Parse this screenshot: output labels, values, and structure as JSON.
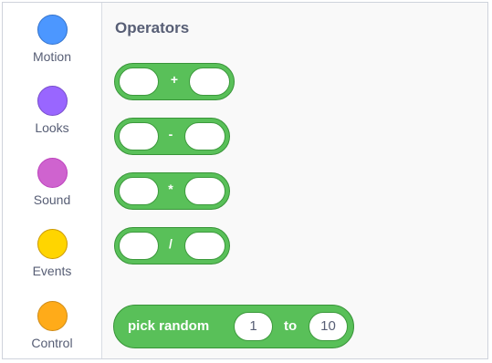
{
  "categories": [
    {
      "label": "Motion",
      "color": "#4c97ff",
      "border": "#3373cc"
    },
    {
      "label": "Looks",
      "color": "#9966ff",
      "border": "#774dcb"
    },
    {
      "label": "Sound",
      "color": "#cf63cf",
      "border": "#bd42bd"
    },
    {
      "label": "Events",
      "color": "#ffd500",
      "border": "#cc9900"
    },
    {
      "label": "Control",
      "color": "#ffab19",
      "border": "#cf8b17"
    }
  ],
  "palette": {
    "heading": "Operators",
    "block_color": "#59c059",
    "blocks": [
      {
        "operator": "+"
      },
      {
        "operator": "-"
      },
      {
        "operator": "*"
      },
      {
        "operator": "/"
      }
    ],
    "pick_random": {
      "label": "pick random",
      "from_value": "1",
      "to_label": "to",
      "to_value": "10"
    }
  }
}
